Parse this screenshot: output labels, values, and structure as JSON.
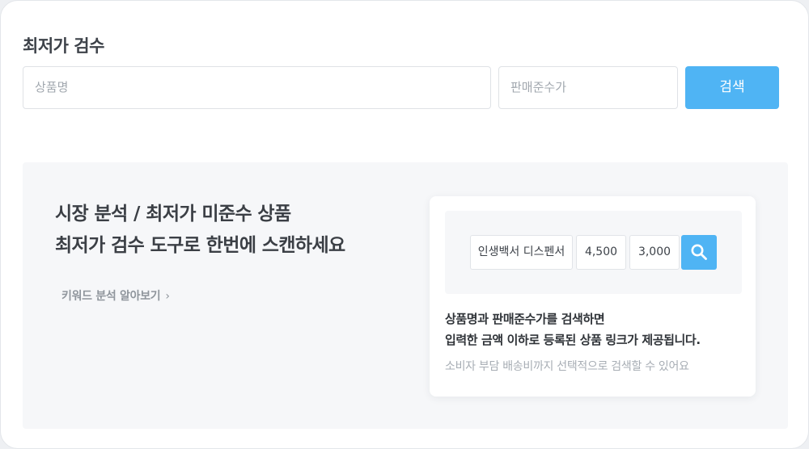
{
  "header": {
    "title": "최저가 검수"
  },
  "search": {
    "product_placeholder": "상품명",
    "price_placeholder": "판매준수가",
    "button_label": "검색"
  },
  "promo": {
    "headline_line1": "시장 분석 / 최저가 미준수 상품",
    "headline_line2": "최저가 검수 도구로 한번에 스캔하세요",
    "keyword_link_label": "키워드 분석 알아보기",
    "demo": {
      "product_value": "인생백서 디스펜서",
      "price_value": "4,500",
      "limit_value": "3,000",
      "search_icon": "search-icon",
      "desc_line1": "상품명과 판매준수가를 검색하면",
      "desc_line2": "입력한 금액 이하로 등록된 상품 링크가 제공됩니다.",
      "subdesc": "소비자 부담 배송비까지 선택적으로 검색할 수 있어요"
    }
  },
  "colors": {
    "accent": "#4fb4f4",
    "panel_bg": "#f6f7f9",
    "text_dark": "#3d4249",
    "text_muted": "#a7adb4"
  }
}
